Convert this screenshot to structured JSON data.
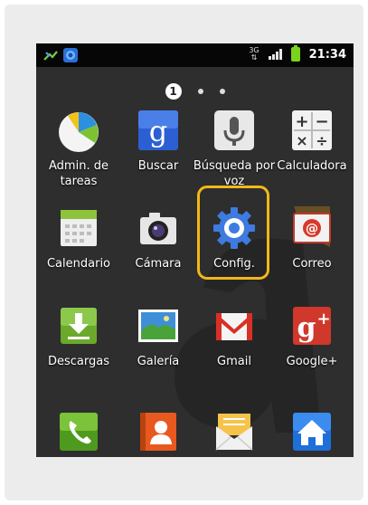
{
  "status_bar": {
    "time": "21:34",
    "network": "3G"
  },
  "home": {
    "page_indicator": "1"
  },
  "apps": [
    {
      "label": "Admin. de tareas",
      "icon": "task-manager-icon"
    },
    {
      "label": "Buscar",
      "icon": "google-search-icon"
    },
    {
      "label": "Búsqueda por voz",
      "icon": "microphone-icon"
    },
    {
      "label": "Calculadora",
      "icon": "calculator-icon"
    },
    {
      "label": "Calendario",
      "icon": "calendar-icon"
    },
    {
      "label": "Cámara",
      "icon": "camera-icon"
    },
    {
      "label": "Config.",
      "icon": "settings-gear-icon"
    },
    {
      "label": "Correo",
      "icon": "email-icon"
    },
    {
      "label": "Descargas",
      "icon": "download-icon"
    },
    {
      "label": "Galería",
      "icon": "gallery-icon"
    },
    {
      "label": "Gmail",
      "icon": "gmail-icon"
    },
    {
      "label": "Google+",
      "icon": "google-plus-icon"
    }
  ],
  "dock": [
    {
      "icon": "phone-icon"
    },
    {
      "icon": "contacts-icon"
    },
    {
      "icon": "messaging-icon"
    },
    {
      "icon": "home-icon"
    }
  ],
  "colors": {
    "highlight": "#f2b817",
    "screen_bg": "#2e2e2e"
  }
}
